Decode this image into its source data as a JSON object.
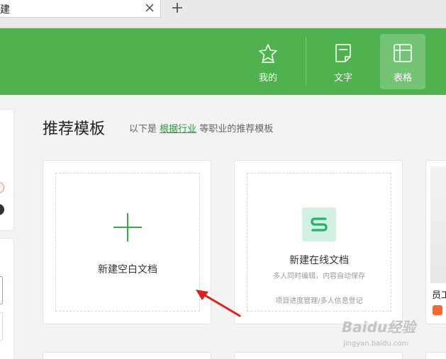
{
  "tab": {
    "title": "建",
    "close_icon": "close-icon",
    "add_icon": "plus-icon"
  },
  "nav": {
    "items": [
      {
        "label": "我的",
        "icon": "star-icon",
        "active": false
      },
      {
        "label": "文字",
        "icon": "document-icon",
        "active": false
      },
      {
        "label": "表格",
        "icon": "table-icon",
        "active": true
      }
    ]
  },
  "section": {
    "title": "推荐模板",
    "subtitle_prefix": "以下是",
    "subtitle_link": "根据行业",
    "subtitle_suffix": "等职业的推荐模板"
  },
  "cards": {
    "blank": {
      "label": "新建空白文档"
    },
    "online": {
      "title": "新建在线文档",
      "description": "多人同时编辑，内容自动保存",
      "footer": "项目进度管理/多人信息登记"
    },
    "partial": {
      "label": "员工"
    }
  },
  "watermark": {
    "brand": "Baidu经验",
    "url": "jingyan.baidu.com"
  },
  "colors": {
    "brand_green": "#4fb24f",
    "link_green": "#2a9a3a",
    "arrow_red": "#e02020"
  }
}
